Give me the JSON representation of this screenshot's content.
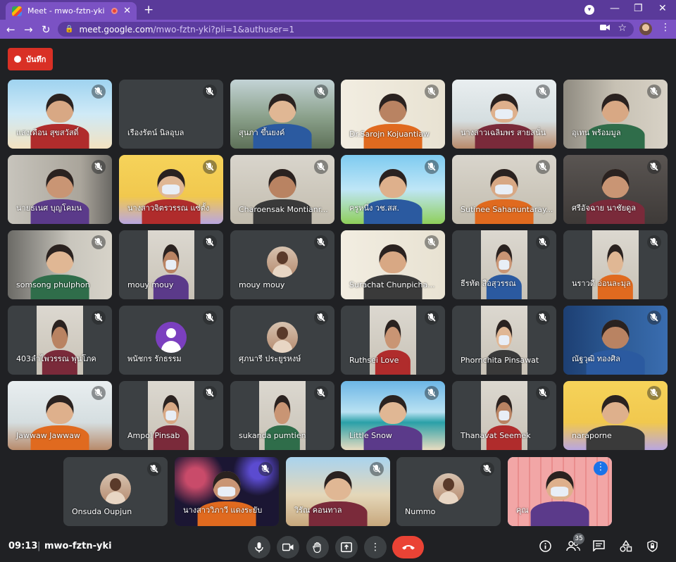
{
  "browser": {
    "tab_title": "Meet - mwo-fztn-yki",
    "url_host": "meet.google.com",
    "url_path": "/mwo-fztn-yki?pli=1&authuser=1",
    "new_tab": "+",
    "close": "✕",
    "back": "←",
    "forward": "→",
    "reload": "↻",
    "lock": "🔒",
    "star": "☆",
    "minimize": "—",
    "maximize": "❐",
    "win_close": "✕",
    "profile_menu": "▾",
    "menu": "⋮"
  },
  "record": {
    "label": "บันทึก"
  },
  "participants": [
    {
      "name": "แสงเดือน สุขสวัสดิ์",
      "style": "beach"
    },
    {
      "name": "เรืองรัตน์ นิลอุบล",
      "style": "gray"
    },
    {
      "name": "สุนภา ขึ้นยงค์",
      "style": "mountain"
    },
    {
      "name": "Dr.Sarojn Kojuantiaw",
      "style": "poster"
    },
    {
      "name": "นางสาวเฉลิมพร สายสนั่น",
      "style": "class"
    },
    {
      "name": "อุเทน พร้อมมูล",
      "style": "office"
    },
    {
      "name": "นายธเนศ บุญโคมน",
      "style": "wall"
    },
    {
      "name": "นางสาวจิตรวรรณ แซ่ตั้ง",
      "style": "cartoon"
    },
    {
      "name": "Charoensak Montianr...",
      "style": "room"
    },
    {
      "name": "ครูหนึ่ง วช.สส.",
      "style": "sun"
    },
    {
      "name": "Sutinee Sahanuntaray...",
      "style": "room"
    },
    {
      "name": "ศรีอัจฉาย นาชัยดูล",
      "style": "dark"
    },
    {
      "name": "somsong phulphon",
      "style": "shelf"
    },
    {
      "name": "mouy mouy",
      "style": "gray-person"
    },
    {
      "name": "mouy mouy",
      "style": "gray-avatar"
    },
    {
      "name": "Surachat Chunpicha...",
      "style": "poster"
    },
    {
      "name": "ธีรทัต สือสุวรรณ",
      "style": "gray-person"
    },
    {
      "name": "นราวดี อ่อนละมุล",
      "style": "gray-person"
    },
    {
      "name": "403ลำไพวรรณ พุนโภค",
      "style": "gray-person"
    },
    {
      "name": "พนัชกร รักธรรม",
      "style": "default-avatar"
    },
    {
      "name": "ศุภนารี ประยูรหงษ์",
      "style": "gray-avatar"
    },
    {
      "name": "Ruthsei Love",
      "style": "gray-person"
    },
    {
      "name": "Phornchita Pinsawat",
      "style": "gray-person"
    },
    {
      "name": "ณัฐวุฒิ ทองศิล",
      "style": "blue-poster"
    },
    {
      "name": "Jawwaw Jawwaw",
      "style": "class"
    },
    {
      "name": "Ampol Pinsab",
      "style": "gray-person"
    },
    {
      "name": "sukanda pumtien",
      "style": "gray-person"
    },
    {
      "name": "Little Snow",
      "style": "beach2"
    },
    {
      "name": "Thanavat Seemek",
      "style": "gray-person"
    },
    {
      "name": "naraporne",
      "style": "cartoon"
    },
    {
      "name": "Onsuda Oupjun",
      "style": "gray-avatar"
    },
    {
      "name": "นางสาววิภาวี แดงระยับ",
      "style": "fireworks"
    },
    {
      "name": "วิรัณ คอนทาล",
      "style": "street"
    },
    {
      "name": "Nummo",
      "style": "gray-avatar"
    },
    {
      "name": "คุณ",
      "style": "pink"
    }
  ],
  "bottom": {
    "time": "09:13",
    "separator": "|",
    "meeting_code": "mwo-fztn-yki",
    "people_count": "35",
    "more": "⋮"
  }
}
